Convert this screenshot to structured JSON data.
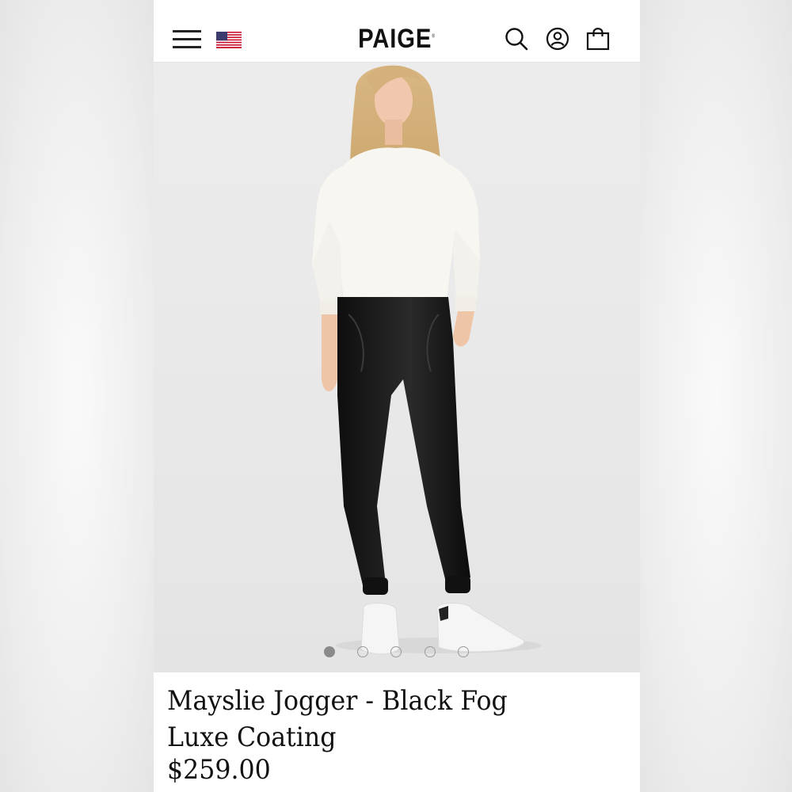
{
  "header": {
    "logo": "PAIGE",
    "logo_mark": "®",
    "icons": [
      "menu-icon",
      "us-flag-icon",
      "search-icon",
      "account-icon",
      "shopping-bag-icon"
    ]
  },
  "gallery": {
    "image_count": 5,
    "active_index": 0
  },
  "product": {
    "title_line1": "Mayslie Jogger - Black Fog",
    "title_line2": "Luxe Coating",
    "price": "$259.00"
  },
  "colors": {
    "text": "#111111",
    "hero_background": "#e9e9e9",
    "dot_active": "#8a8a8a"
  }
}
